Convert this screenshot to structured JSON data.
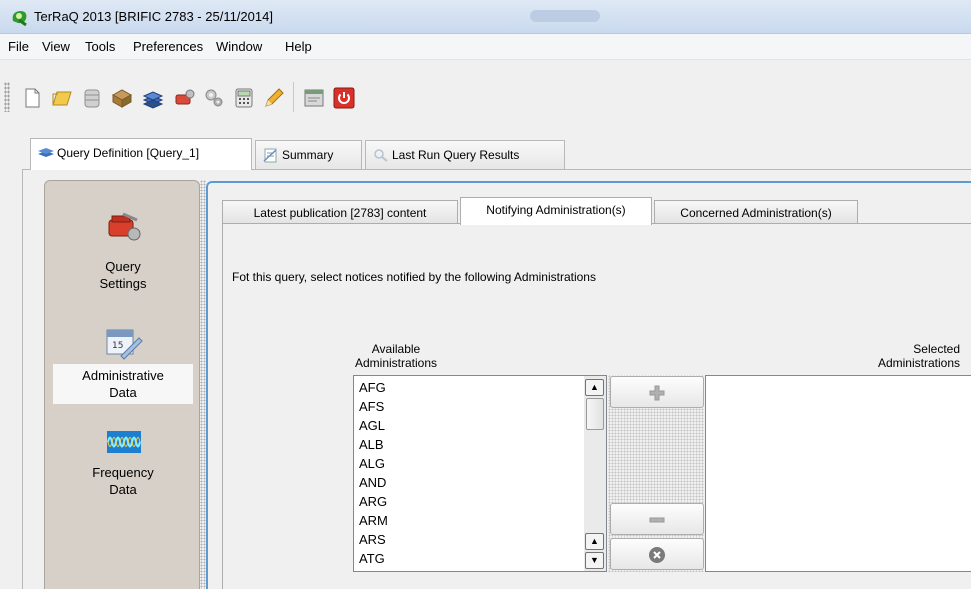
{
  "window": {
    "title": "TerRaQ 2013 [BRIFIC 2783 - 25/11/2014]"
  },
  "menu": [
    "File",
    "View",
    "Tools",
    "Preferences",
    "Window",
    "Help"
  ],
  "toolbar": {
    "icons": [
      "new-file-icon",
      "open-folder-icon",
      "database-icon",
      "package-icon",
      "query-stack-icon",
      "settings-tool-icon",
      "gears-icon",
      "calculator-icon",
      "pencil-icon",
      "window-icon",
      "power-icon"
    ]
  },
  "main_tabs": [
    {
      "label": "Query Definition [Query_1]",
      "active": true
    },
    {
      "label": "Summary",
      "active": false
    },
    {
      "label": "Last Run Query Results",
      "active": false
    }
  ],
  "left_nav": [
    {
      "label_line1": "Query",
      "label_line2": "Settings",
      "icon": "toolbox-icon"
    },
    {
      "label_line1": "Administrative",
      "label_line2": "Data",
      "icon": "calendar-icon",
      "selected": true
    },
    {
      "label_line1": "Frequency",
      "label_line2": "Data",
      "icon": "frequency-icon"
    }
  ],
  "sub_tabs": [
    {
      "label": "Latest publication [2783] content",
      "active": false
    },
    {
      "label": "Notifying Administration(s)",
      "active": true
    },
    {
      "label": "Concerned Administration(s)",
      "active": false
    }
  ],
  "instruction": "Fot this query, select notices notified by the following Administrations",
  "available": {
    "header_line1": "Available",
    "header_line2": "Administrations",
    "items": [
      "AFG",
      "AFS",
      "AGL",
      "ALB",
      "ALG",
      "AND",
      "ARG",
      "ARM",
      "ARS",
      "ATG"
    ]
  },
  "selected": {
    "header_line1": "Selected",
    "header_line2": "Administrations",
    "items": []
  },
  "colors": {
    "accent_border": "#5b9ad5",
    "nav_bg": "#d6d0c8",
    "power_red": "#d9302a"
  }
}
